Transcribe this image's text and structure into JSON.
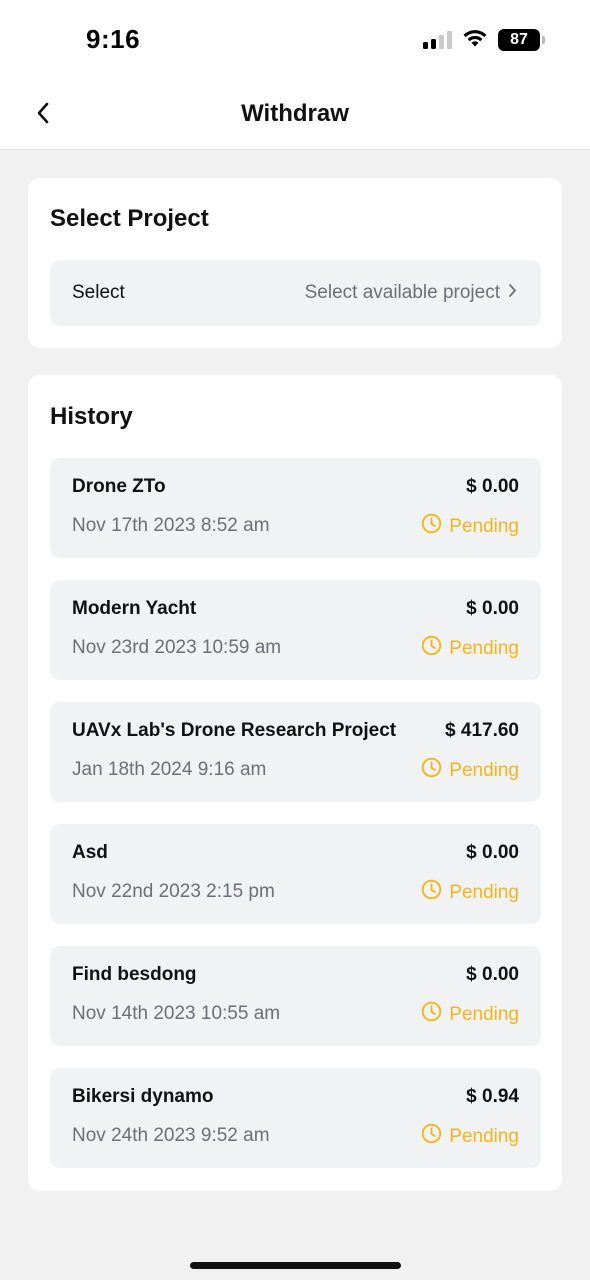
{
  "status_bar": {
    "time": "9:16",
    "battery": "87",
    "signal_icon": "signal-bars-icon",
    "wifi_icon": "wifi-icon"
  },
  "nav": {
    "title": "Withdraw",
    "back_icon": "chevron-left-icon"
  },
  "select_project": {
    "heading": "Select Project",
    "label": "Select",
    "placeholder": "Select available project",
    "chevron_icon": "chevron-right-icon"
  },
  "history": {
    "heading": "History",
    "status_icon": "clock-icon",
    "status_color": "#f4b51a",
    "items": [
      {
        "name": "Drone ZTo",
        "amount": "$ 0.00",
        "date": "Nov 17th 2023 8:52 am",
        "status": "Pending"
      },
      {
        "name": "Modern Yacht",
        "amount": "$ 0.00",
        "date": "Nov 23rd 2023 10:59 am",
        "status": "Pending"
      },
      {
        "name": "UAVx Lab's Drone Research Project",
        "amount": "$ 417.60",
        "date": "Jan 18th 2024 9:16 am",
        "status": "Pending"
      },
      {
        "name": "Asd",
        "amount": "$ 0.00",
        "date": "Nov 22nd 2023 2:15 pm",
        "status": "Pending"
      },
      {
        "name": "Find besdong",
        "amount": "$ 0.00",
        "date": "Nov 14th 2023 10:55 am",
        "status": "Pending"
      },
      {
        "name": "Bikersi dynamo",
        "amount": "$ 0.94",
        "date": "Nov 24th 2023 9:52 am",
        "status": "Pending"
      }
    ]
  }
}
